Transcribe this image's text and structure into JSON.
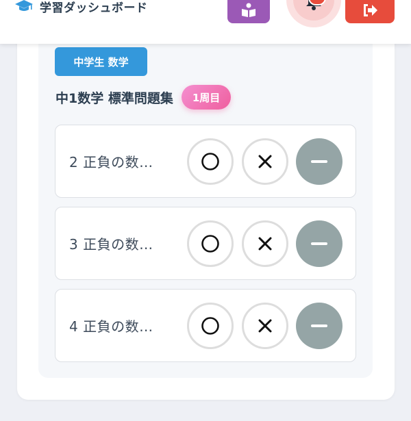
{
  "header": {
    "app_title": "学習ダッシュボード",
    "brand_icon": "graduation-cap-icon",
    "study_button_icon": "book-reader-icon",
    "bell_icon": "bell-icon",
    "logout_icon": "sign-out-icon"
  },
  "section": {
    "subject_badge": "中学生 数学",
    "book_title": "中1数学 標準問題集",
    "round_badge": "1周目"
  },
  "questions": [
    {
      "label": "2 正負の数…",
      "correct_symbol": "○",
      "wrong_symbol": "×",
      "skip_symbol": "−"
    },
    {
      "label": "3 正負の数…",
      "correct_symbol": "○",
      "wrong_symbol": "×",
      "skip_symbol": "−"
    },
    {
      "label": "4 正負の数…",
      "correct_symbol": "○",
      "wrong_symbol": "×",
      "skip_symbol": "−"
    }
  ],
  "colors": {
    "accent_blue": "#3498db",
    "study_purple": "#9b59b6",
    "logout_red": "#e74c3c",
    "round_pink": "#ef5f9e",
    "skip_gray": "#95a5a6"
  }
}
